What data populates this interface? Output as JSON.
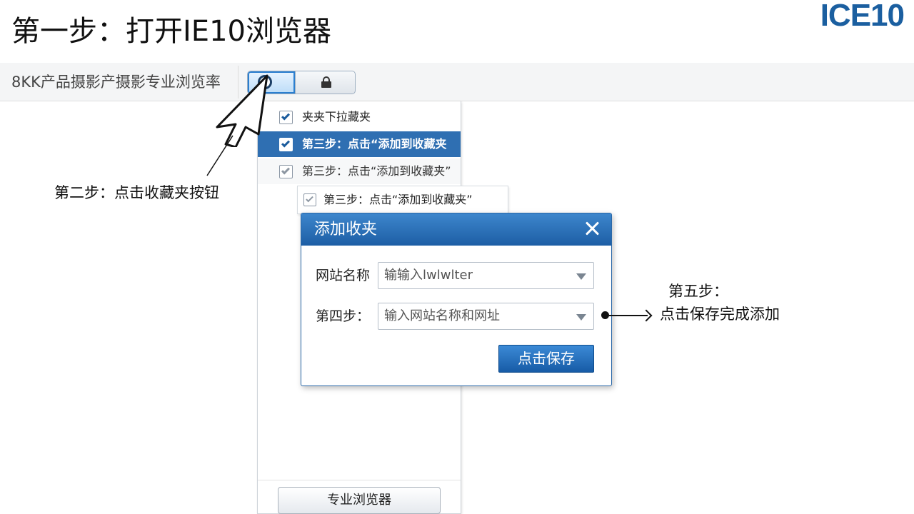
{
  "header": {
    "title": "第一步：打开IE10浏览器",
    "logo": "ICE10"
  },
  "toolbar": {
    "text": "8KK产品摄影产摄影专业浏览率",
    "left_toggle_icon": "circle-icon",
    "right_toggle_icon": "lock-icon"
  },
  "dropdown": {
    "items": [
      {
        "label": "夹夹下拉藏夹",
        "checked": true,
        "state": "normal"
      },
      {
        "label": "第三步：点击“添加到收藏夹",
        "checked": true,
        "state": "selected"
      },
      {
        "label": "第三步：点击“添加到收藏夹”",
        "checked": true,
        "state": "dim"
      }
    ],
    "submenu_item": {
      "label": "第三步：点击“添加到收藏夹”",
      "checked": true
    },
    "bottom_button": "专业浏览器"
  },
  "dialog": {
    "title": "添加收夹",
    "fields": [
      {
        "label": "网站名称",
        "value": "输输入lwlwlter"
      },
      {
        "label": "第四步：",
        "value": "输入网站名称和网址"
      }
    ],
    "save_button": "点击保存"
  },
  "annotations": {
    "step2": "第二步：点击收藏夹按钮",
    "step5_line1": "第五步：",
    "step5_line2": "点击保存完成添加"
  },
  "colors": {
    "accent": "#2f6fb2",
    "logo": "#1b5fa0",
    "dialog_header": "#1d5ea5"
  }
}
